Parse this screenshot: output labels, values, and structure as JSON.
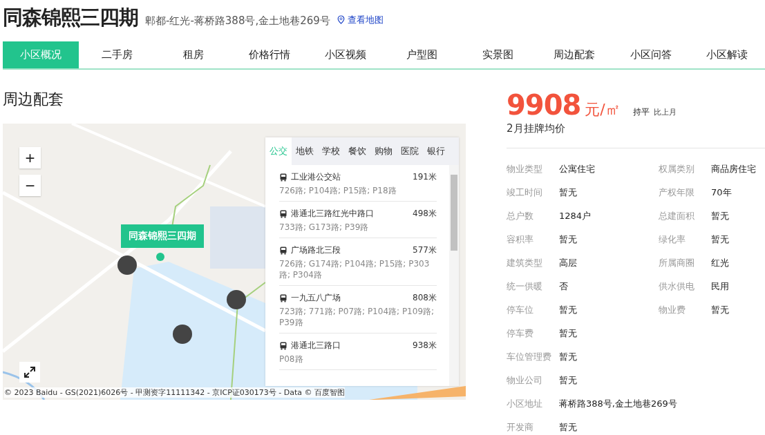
{
  "header": {
    "title": "同森锦熙三四期",
    "address": "郫都-红光-蒋桥路388号,金土地巷269号",
    "map_link": "查看地图"
  },
  "tabs": [
    {
      "label": "小区概况",
      "selected": true
    },
    {
      "label": "二手房",
      "selected": false
    },
    {
      "label": "租房",
      "selected": false
    },
    {
      "label": "价格行情",
      "selected": false
    },
    {
      "label": "小区视频",
      "selected": false
    },
    {
      "label": "户型图",
      "selected": false
    },
    {
      "label": "实景图",
      "selected": false
    },
    {
      "label": "周边配套",
      "selected": false
    },
    {
      "label": "小区问答",
      "selected": false
    },
    {
      "label": "小区解读",
      "selected": false
    }
  ],
  "section_title": "周边配套",
  "map": {
    "kind": "picture",
    "marker_label": "同森锦熙三四期",
    "zoom_in": "+",
    "zoom_out": "−",
    "copyright": "© 2023 Baidu - GS(2021)6026号 - 甲测资字11111342 - 京ICP证030173号 - Data © 百度智图",
    "poi_tabs": [
      {
        "label": "公交",
        "selected": true
      },
      {
        "label": "地铁",
        "selected": false
      },
      {
        "label": "学校",
        "selected": false
      },
      {
        "label": "餐饮",
        "selected": false
      },
      {
        "label": "购物",
        "selected": false
      },
      {
        "label": "医院",
        "selected": false
      },
      {
        "label": "银行",
        "selected": false
      }
    ],
    "poi_list": [
      {
        "name": "工业港公交站",
        "distance": "191米",
        "routes": "726路; P104路; P15路; P18路"
      },
      {
        "name": "港通北三路红光中路口",
        "distance": "498米",
        "routes": "733路; G173路; P39路"
      },
      {
        "name": "广场路北三段",
        "distance": "577米",
        "routes": "726路; G174路; P104路; P15路; P303路; P304路"
      },
      {
        "name": "一九五八广场",
        "distance": "808米",
        "routes": "723路; 771路; P07路; P104路; P109路; P39路"
      },
      {
        "name": "港通北三路口",
        "distance": "938米",
        "routes": "P08路"
      }
    ]
  },
  "price": {
    "value": "9908",
    "unit": "元/㎡",
    "trend": "持平",
    "trend_note": "比上月",
    "caption": "2月挂牌均价"
  },
  "property_rows": [
    [
      {
        "label": "物业类型",
        "value": "公寓住宅"
      },
      {
        "label": "权属类别",
        "value": "商品房住宅"
      }
    ],
    [
      {
        "label": "竣工时间",
        "value": "暂无"
      },
      {
        "label": "产权年限",
        "value": "70年"
      }
    ],
    [
      {
        "label": "总户数",
        "value": "1284户"
      },
      {
        "label": "总建面积",
        "value": "暂无"
      }
    ],
    [
      {
        "label": "容积率",
        "value": "暂无"
      },
      {
        "label": "绿化率",
        "value": "暂无"
      }
    ],
    [
      {
        "label": "建筑类型",
        "value": "高层"
      },
      {
        "label": "所属商圈",
        "value": "红光"
      }
    ],
    [
      {
        "label": "统一供暖",
        "value": "否"
      },
      {
        "label": "供水供电",
        "value": "民用"
      }
    ],
    [
      {
        "label": "停车位",
        "value": "暂无"
      },
      {
        "label": "物业费",
        "value": "暂无"
      }
    ],
    [
      {
        "label": "停车费",
        "value": "暂无"
      }
    ],
    [
      {
        "label": "车位管理费",
        "value": "暂无"
      }
    ],
    [
      {
        "label": "物业公司",
        "value": "暂无"
      }
    ],
    [
      {
        "label": "小区地址",
        "value": "蒋桥路388号,金土地巷269号"
      }
    ],
    [
      {
        "label": "开发商",
        "value": "暂无"
      }
    ]
  ]
}
